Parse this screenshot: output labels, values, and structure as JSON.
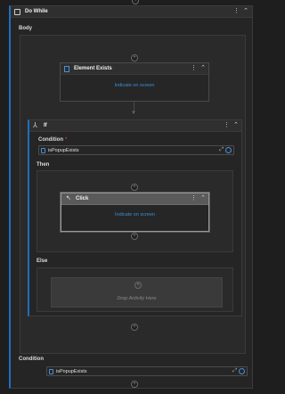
{
  "do_while": {
    "title": "Do While",
    "body_label": "Body",
    "condition_label": "Condition",
    "condition_value": "isPopupExists"
  },
  "element_exists": {
    "title": "Element Exists",
    "link": "Indicate on screen"
  },
  "if_activity": {
    "title": "If",
    "condition_label": "Condition",
    "required_mark": "*",
    "condition_value": "isPopupExists",
    "then_label": "Then",
    "else_label": "Else",
    "drop_placeholder": "Drop Activity Here"
  },
  "click": {
    "title": "Click",
    "link": "Indicate on screen"
  },
  "glyphs": {
    "plus": "+",
    "kebab": "⋮",
    "collapse": "⌃",
    "expand": "⤢",
    "arrow": "▼"
  },
  "colors": {
    "accent_blue": "#1f6fbf",
    "link_blue": "#3b8fd8",
    "background": "#1e1e1e",
    "panel": "#252526",
    "selected_header": "#5a5a5a"
  }
}
